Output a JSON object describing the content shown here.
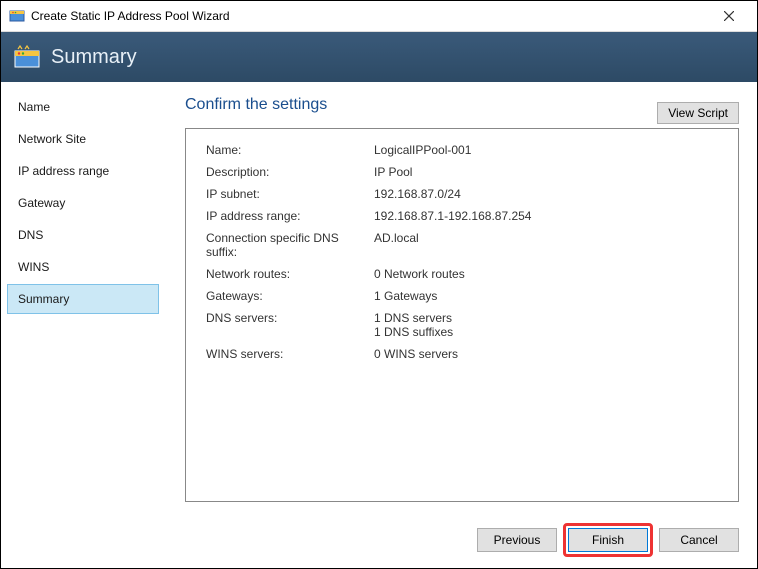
{
  "titlebar": {
    "title": "Create Static IP Address Pool Wizard"
  },
  "banner": {
    "title": "Summary"
  },
  "sidebar": {
    "items": [
      {
        "label": "Name",
        "selected": false
      },
      {
        "label": "Network Site",
        "selected": false
      },
      {
        "label": "IP address range",
        "selected": false
      },
      {
        "label": "Gateway",
        "selected": false
      },
      {
        "label": "DNS",
        "selected": false
      },
      {
        "label": "WINS",
        "selected": false
      },
      {
        "label": "Summary",
        "selected": true
      }
    ]
  },
  "content": {
    "heading": "Confirm the settings",
    "viewScriptLabel": "View Script",
    "rows": [
      {
        "label": "Name:",
        "value": "LogicalIPPool-001"
      },
      {
        "label": "Description:",
        "value": "IP Pool"
      },
      {
        "label": "IP subnet:",
        "value": "192.168.87.0/24"
      },
      {
        "label": "IP address range:",
        "value": "192.168.87.1-192.168.87.254"
      },
      {
        "label": "Connection specific DNS suffix:",
        "value": "AD.local"
      },
      {
        "label": "Network routes:",
        "value": "0 Network routes"
      },
      {
        "label": "Gateways:",
        "value": "1 Gateways"
      },
      {
        "label": "DNS servers:",
        "value": "1 DNS servers\n1 DNS suffixes"
      },
      {
        "label": "WINS servers:",
        "value": "0 WINS servers"
      }
    ]
  },
  "footer": {
    "previous": "Previous",
    "finish": "Finish",
    "cancel": "Cancel"
  }
}
